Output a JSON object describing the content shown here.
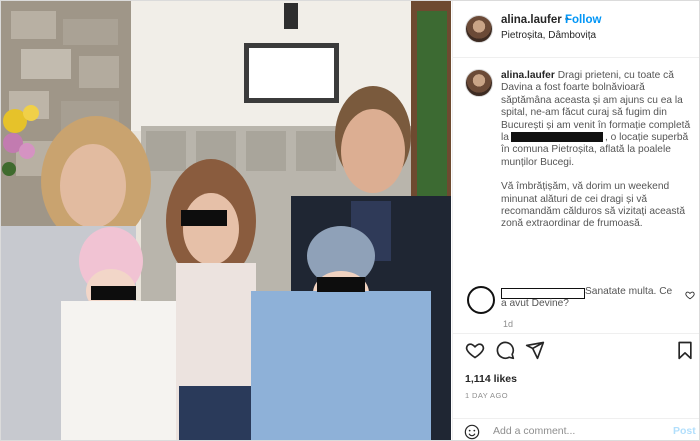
{
  "header": {
    "username": "alina.laufer",
    "separator": "•",
    "follow_label": "Follow",
    "location": "Pietroșita, Dâmbovița"
  },
  "caption": {
    "username": "alina.laufer",
    "text_part1": "Dragi prieteni, cu toate că Davina a fost foarte bolnăvioară săptămâna aceasta și am ajuns cu ea la spital, ne-am făcut curaj să fugim din București și am venit în formație completă la",
    "text_part2": ", o locație superbă în comuna Pietroșita, aflată la poalele munților Bucegi.",
    "paragraph2": "Vă îmbrățișăm, vă dorim un weekend minunat alături de cei dragi și vă recomandăm călduros să vizitați această zonă extraordinar de frumoasă.",
    "age": "1d"
  },
  "comment": {
    "text_line1": "Sanatate multa. Ce",
    "text_line2": "a avut Devine?"
  },
  "likes": "1,114 likes",
  "time_ago": "1 DAY AGO",
  "add_comment": {
    "placeholder": "Add a comment...",
    "post_label": "Post"
  },
  "icons": {
    "heart": "heart-icon",
    "comment": "comment-icon",
    "share": "share-icon",
    "save": "bookmark-icon",
    "emoji": "emoji-icon"
  },
  "colors": {
    "follow_blue": "#0095f6",
    "post_disabled": "#b2dffc",
    "border": "#dbdbdb"
  }
}
